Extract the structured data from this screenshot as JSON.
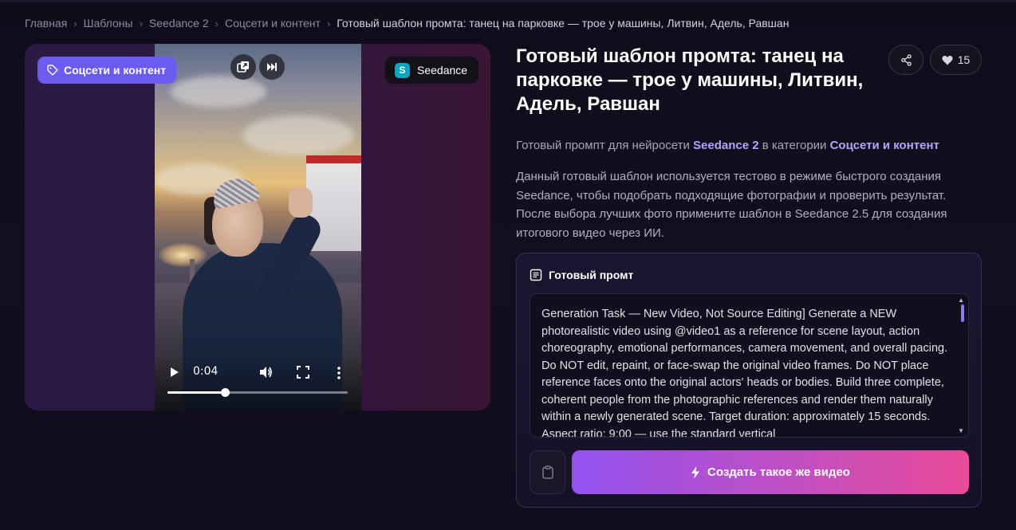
{
  "breadcrumb": {
    "items": [
      "Главная",
      "Шаблоны",
      "Seedance 2",
      "Соцсети и контент"
    ],
    "current": "Готовый шаблон промта: танец на парковке — трое у машины, Литвин, Адель, Равшан"
  },
  "media": {
    "category_badge": "Соцсети и контент",
    "model_badge": "Seedance",
    "model_logo_letter": "S",
    "video": {
      "time": "0:04",
      "progress": 0.32
    }
  },
  "title": "Готовый шаблон промта: танец на парковке — трое у машины, Литвин, Адель, Равшан",
  "actions": {
    "likes": "15"
  },
  "lead": {
    "prefix": "Готовый промпт для нейросети",
    "model": "Seedance 2",
    "middle": "в категории",
    "category": "Соцсети и контент"
  },
  "description": "Данный готовый шаблон используется тестово в режиме быстрого создания Seedance, чтобы подобрать подходящие фотографии и проверить результат. После выбора лучших фото примените шаблон в Seedance 2.5 для создания итогового видео через ИИ.",
  "prompt": {
    "heading": "Готовый промт",
    "text": "Generation Task — New Video, Not Source Editing] Generate a NEW photorealistic video using @video1 as a reference for scene layout, action choreography, emotional performances, camera movement, and overall pacing. Do NOT edit, repaint, or face-swap the original video frames. Do NOT place reference faces onto the original actors' heads or bodies. Build three complete, coherent people from the photographic references and render them naturally within a newly generated scene. Target duration: approximately 15 seconds. Aspect ratio: 9:00 — use the standard vertical",
    "create_button": "Создать такое же видео"
  },
  "colors": {
    "accent": "#6b5bf0",
    "link": "#b7a4ff",
    "gradient_start": "#9352f0",
    "gradient_end": "#ea4b99"
  },
  "icons": {
    "category": "tag-icon",
    "share": "share-icon",
    "like": "heart-icon",
    "prompt": "document-icon",
    "copy": "clipboard-icon",
    "create": "lightning-icon"
  }
}
